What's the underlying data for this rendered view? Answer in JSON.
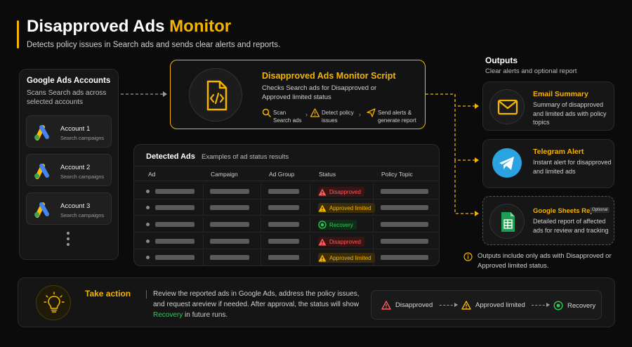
{
  "header": {
    "title_main": "Disapproved Ads",
    "title_highlight": "Monitor",
    "subtitle": "Detects policy issues in Search ads and sends clear alerts and reports."
  },
  "accounts": {
    "title": "Google Ads Accounts",
    "description": "Scans Search ads across selected accounts",
    "items": [
      {
        "name": "Account 1",
        "sub": "Search campaigns"
      },
      {
        "name": "Account 2",
        "sub": "Search campaigns"
      },
      {
        "name": "Account 3",
        "sub": "Search campaigns"
      }
    ]
  },
  "script": {
    "title": "Disapproved Ads Monitor Script",
    "description": "Checks Search ads for Disapproved or Approved limited status",
    "steps": [
      {
        "line1": "Scan",
        "line2": "Search ads",
        "icon": "search-icon"
      },
      {
        "line1": "Detect policy",
        "line2": "issues",
        "icon": "warning-icon"
      },
      {
        "line1": "Send alerts &",
        "line2": "generate report",
        "icon": "send-icon"
      }
    ]
  },
  "table": {
    "title": "Detected Ads",
    "subtitle": "Examples of ad status results",
    "columns": [
      "Ad",
      "Campaign",
      "Ad Group",
      "Status",
      "Policy Topic"
    ],
    "rows": [
      {
        "status": "Disapproved",
        "kind": "disapproved"
      },
      {
        "status": "Approved limited",
        "kind": "limited"
      },
      {
        "status": "Recovery",
        "kind": "recovery"
      },
      {
        "status": "Disapproved",
        "kind": "disapproved"
      },
      {
        "status": "Approved limited",
        "kind": "limited"
      }
    ]
  },
  "outputs": {
    "title": "Outputs",
    "subtitle": "Clear alerts and optional report",
    "items": [
      {
        "name": "Email Summary",
        "description": "Summary of disapproved and limited ads with policy topics",
        "icon": "mail-icon"
      },
      {
        "name": "Telegram Alert",
        "description": "Instant alert for disapproved and limited ads",
        "icon": "telegram-icon"
      },
      {
        "name": "Google Sheets Report",
        "badge": "Optional",
        "description": "Detailed report of affected ads for review and tracking",
        "icon": "sheets-icon"
      }
    ],
    "note": "Outputs include only ads with Disapproved or Approved limited status."
  },
  "action": {
    "title": "Take action",
    "text_before": "Review the reported ads in Google Ads, address the policy issues, and request areview if needed. After approval, the status will show",
    "text_highlight": "Recovery",
    "text_after": "in future runs.",
    "flow": [
      "Disapproved",
      "Approved limited",
      "Recovery"
    ]
  },
  "colors": {
    "accent": "#f5b400",
    "disapproved": "#ff5a5a",
    "limited": "#f5b400",
    "recovery": "#34c759",
    "telegram": "#2aa3e0",
    "sheets": "#1f9d55"
  }
}
